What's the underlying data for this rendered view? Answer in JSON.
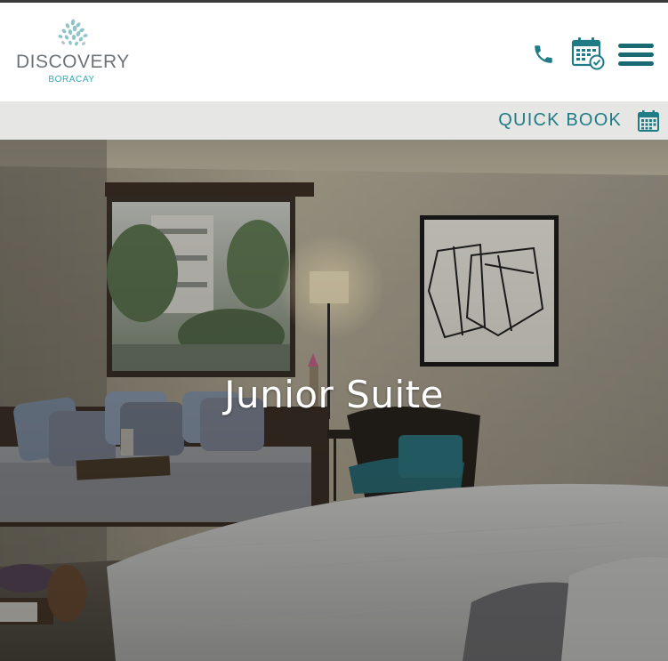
{
  "brand": {
    "name": "DISCOVERY",
    "location": "BORACAY"
  },
  "header": {
    "icons": [
      "phone-icon",
      "booking-calendar-icon",
      "menu-icon"
    ]
  },
  "quick_book": {
    "label": "QUICK BOOK",
    "icon": "calendar-icon"
  },
  "hero": {
    "title": "Junior Suite"
  },
  "colors": {
    "brand_teal": "#1f7c86",
    "logo_gray": "#6e7378",
    "logo_aqua": "#35a8b0",
    "quickbar_bg": "#e6e6e4"
  }
}
